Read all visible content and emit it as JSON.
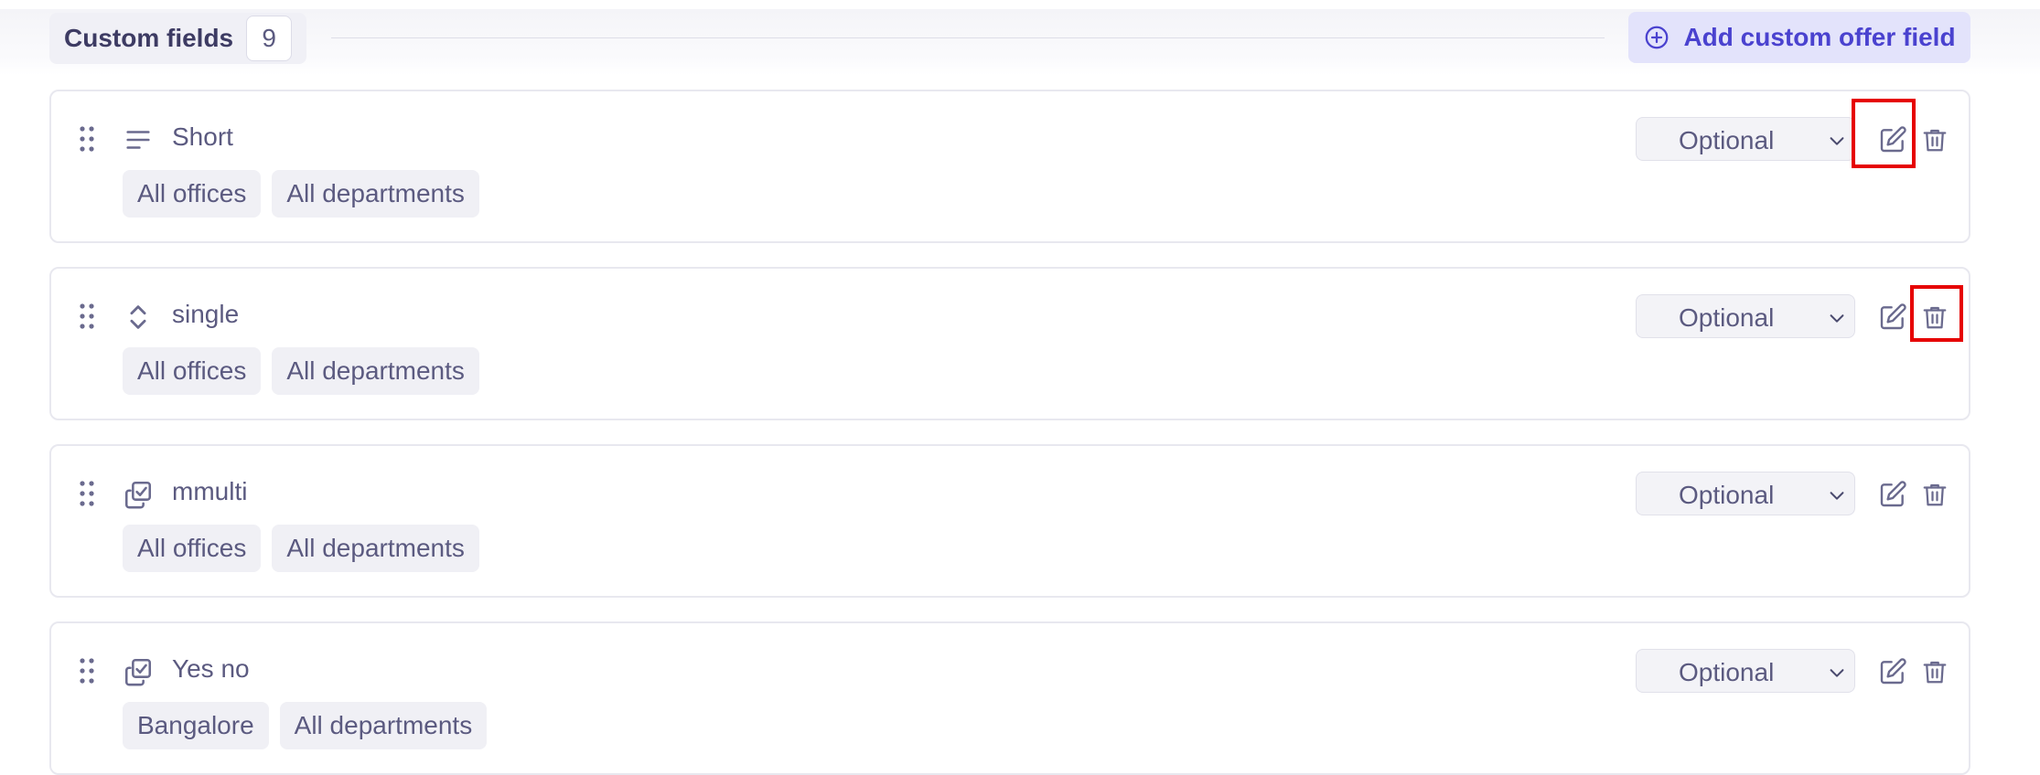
{
  "header": {
    "title": "Custom fields",
    "count": "9",
    "add_button_label": "Add custom offer field"
  },
  "fields": [
    {
      "name": "Short",
      "type_icon": "text-lines-icon",
      "requirement": "Optional",
      "tags": [
        "All offices",
        "All departments"
      ]
    },
    {
      "name": "single",
      "type_icon": "select-updown-icon",
      "requirement": "Optional",
      "tags": [
        "All offices",
        "All departments"
      ]
    },
    {
      "name": "mmulti",
      "type_icon": "multi-checkbox-icon",
      "requirement": "Optional",
      "tags": [
        "All offices",
        "All departments"
      ]
    },
    {
      "name": "Yes no",
      "type_icon": "multi-checkbox-icon",
      "requirement": "Optional",
      "tags": [
        "Bangalore",
        "All departments"
      ]
    }
  ],
  "colors": {
    "accent": "#4a42cf",
    "accent_bg": "#e3e3fb",
    "highlight": "#e60000",
    "text": "#5b5a80"
  }
}
